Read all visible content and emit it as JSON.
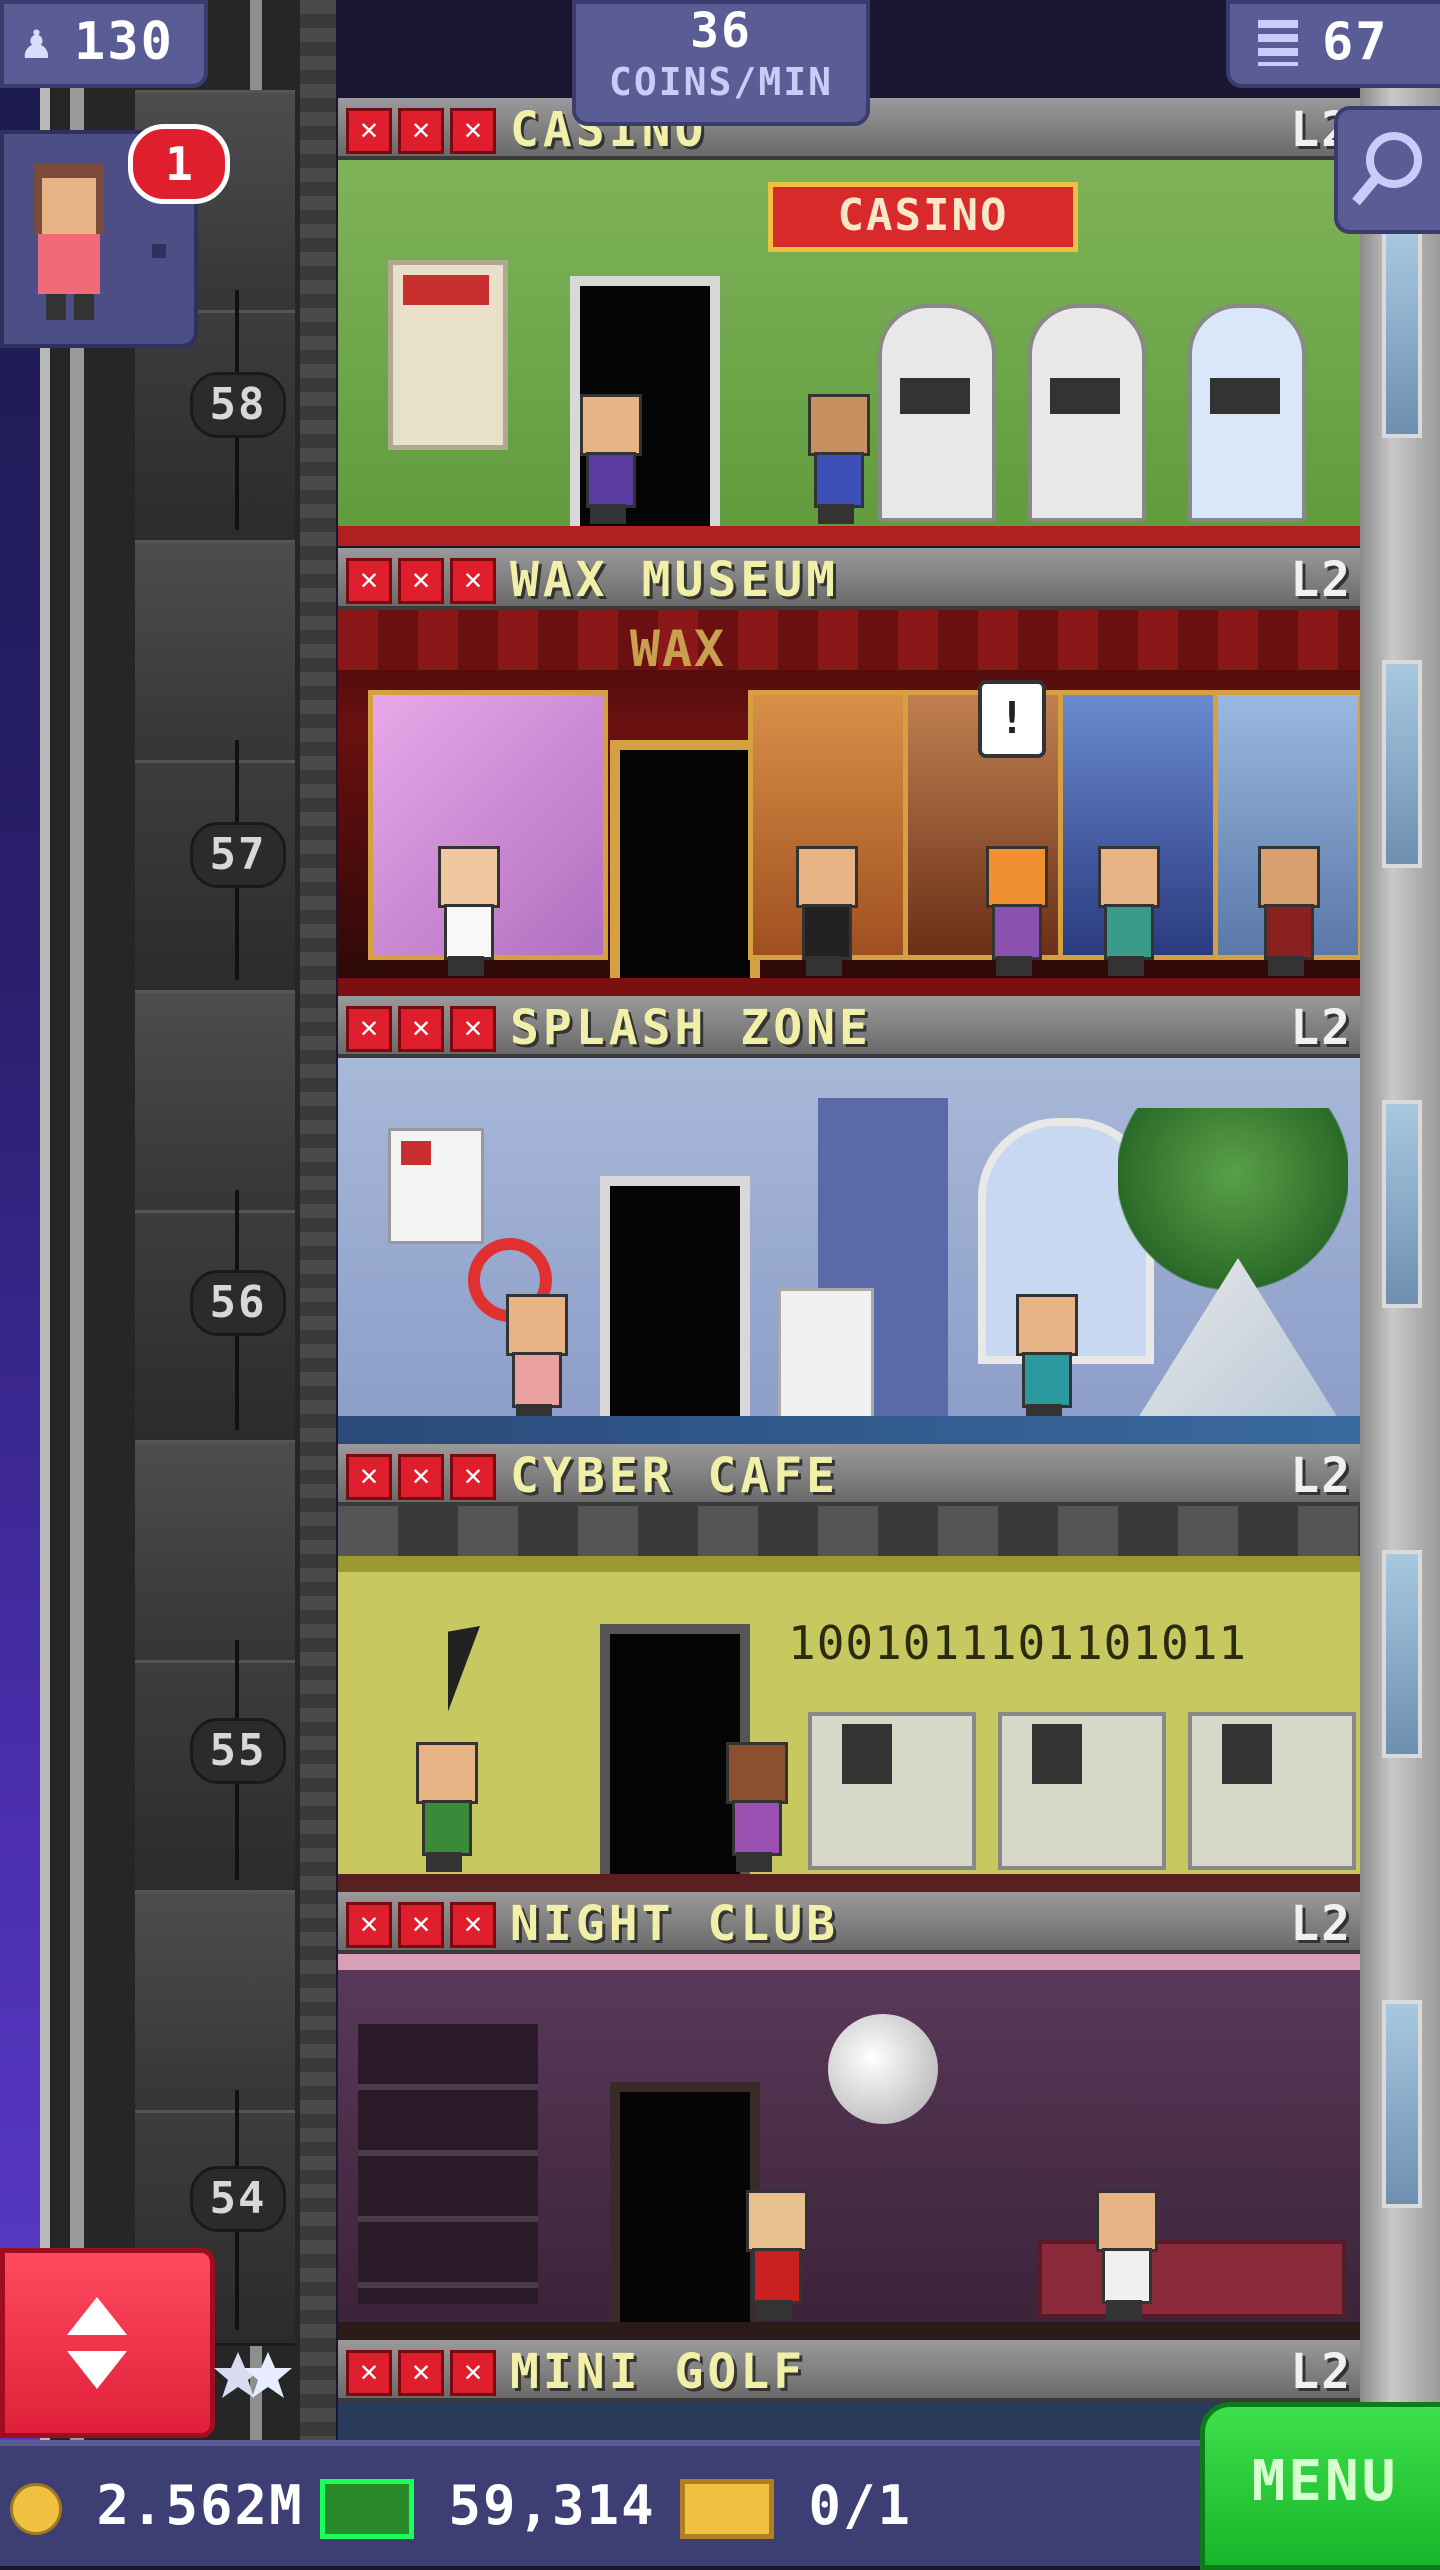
{
  "hud": {
    "population": "130",
    "coins_per_min_value": "36",
    "coins_per_min_label": "COINS/MIN",
    "floor_count": "67",
    "notification_count": "1"
  },
  "floors": [
    {
      "name": "CASINO",
      "level": "L2",
      "number": "58",
      "sign": "CASINO"
    },
    {
      "name": "WAX MUSEUM",
      "level": "L2",
      "number": "57",
      "sign": "WAX"
    },
    {
      "name": "SPLASH ZONE",
      "level": "L2",
      "number": "56"
    },
    {
      "name": "CYBER CAFE",
      "level": "L2",
      "number": "55",
      "wall_text": "1001011101101011"
    },
    {
      "name": "NIGHT CLUB",
      "level": "L2",
      "number": "54"
    },
    {
      "name": "MINI GOLF",
      "level": "L2"
    }
  ],
  "bottom": {
    "coins": "2.562M",
    "bux": "59,314",
    "tickets": "0/1",
    "menu_label": "MENU"
  },
  "colors": {
    "hud_bg": "#5a5c96",
    "star_red": "#e01f2e",
    "menu_green": "#2fd03c",
    "floor_name_yellow": "#f2f0a8"
  }
}
